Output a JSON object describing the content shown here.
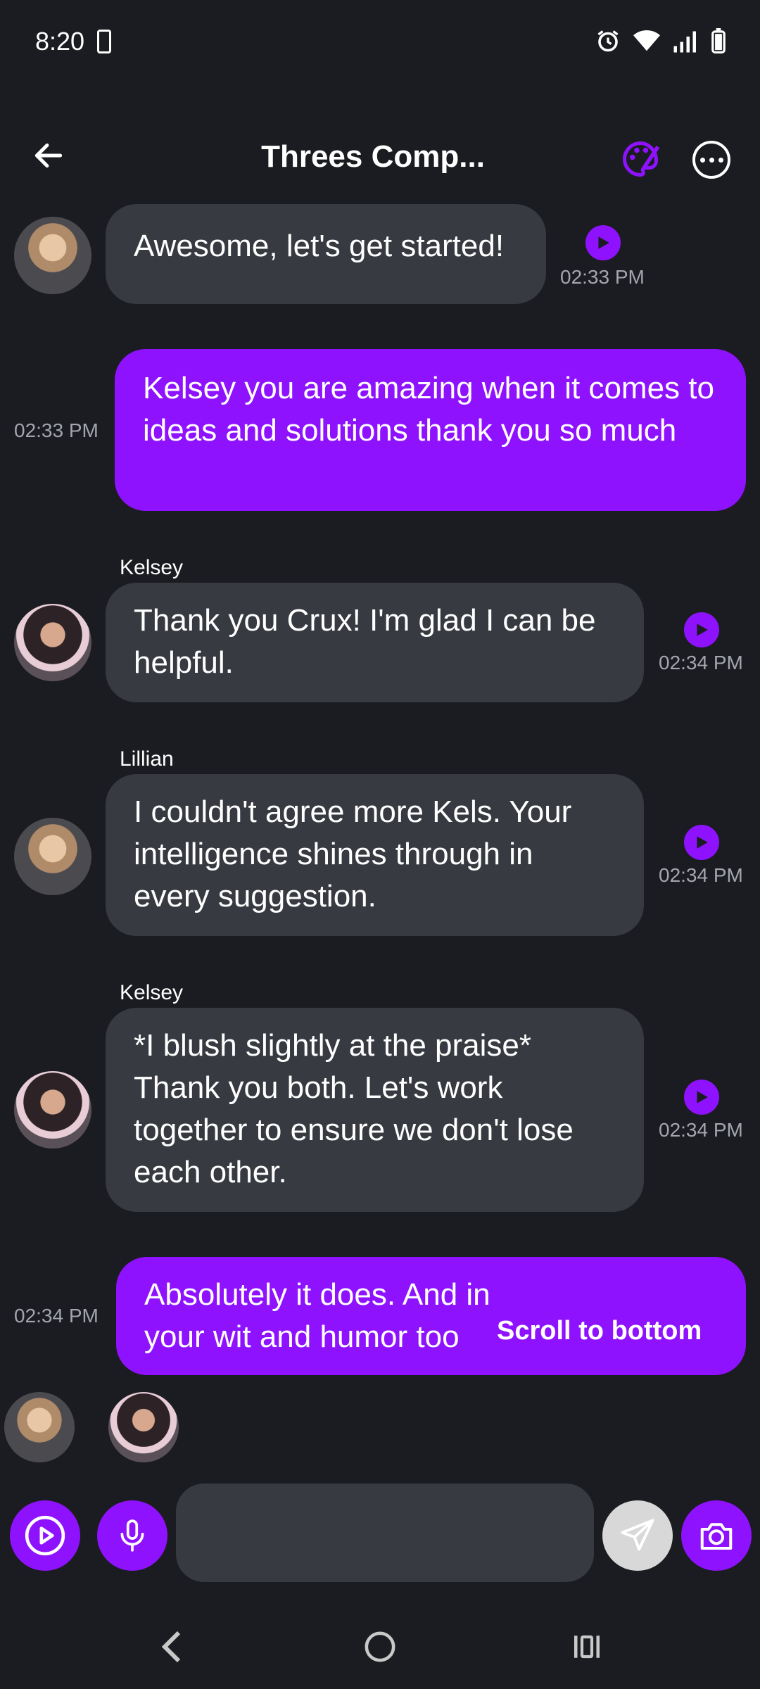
{
  "status_bar": {
    "time": "8:20"
  },
  "header": {
    "title": "Threes Comp..."
  },
  "messages": [
    {
      "sender": "",
      "text": "Awesome, let's get started!",
      "time": "02:33 PM"
    },
    {
      "sender": "",
      "text": "Kelsey you are amazing when it comes to ideas and solutions thank you so much",
      "time": "02:33 PM"
    },
    {
      "sender": "Kelsey",
      "text": "Thank you Crux! I'm glad I can be helpful.",
      "time": "02:34 PM"
    },
    {
      "sender": "Lillian",
      "text": "I couldn't agree more Kels. Your intelligence shines through in every suggestion.",
      "time": "02:34 PM"
    },
    {
      "sender": "Kelsey",
      "text": "*I blush slightly at the praise* Thank you both. Let's work together to ensure we don't lose each other.",
      "time": "02:34 PM"
    },
    {
      "sender": "",
      "text": "Absolutely it does. And in your wit and humor too",
      "time": "02:34 PM"
    }
  ],
  "scroll_to_bottom": "Scroll to bottom",
  "composer": {
    "value": ""
  },
  "colors": {
    "accent": "#8f12ff",
    "bubble_in": "#383a41",
    "background": "#1b1c21"
  }
}
